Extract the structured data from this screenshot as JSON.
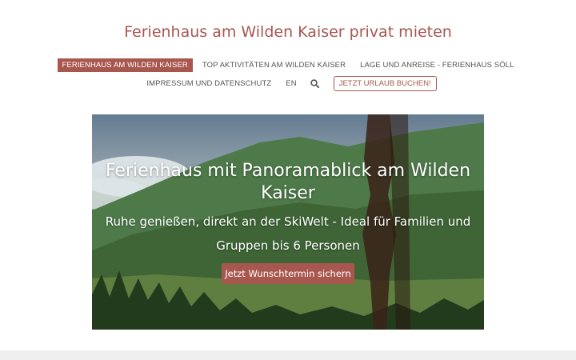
{
  "site": {
    "title": "Ferienhaus am Wilden Kaiser privat mieten"
  },
  "nav": {
    "items": [
      {
        "label": "FERIENHAUS AM WILDEN KAISER",
        "active": true
      },
      {
        "label": "TOP AKTIVITÄTEN AM WILDEN KAISER",
        "active": false
      },
      {
        "label": "LAGE UND ANREISE - FERIENHAUS SÖLL",
        "active": false
      },
      {
        "label": "IMPRESSUM UND DATENSCHUTZ",
        "active": false
      },
      {
        "label": "EN",
        "active": false
      }
    ],
    "search_icon": "search-icon",
    "cta_label": "JETZT URLAUB BUCHEN!"
  },
  "hero": {
    "heading": "Ferienhaus mit Panoramablick am Wilden Kaiser",
    "subheading": "Ruhe genießen, direkt an der SkiWelt - Ideal für Familien und Gruppen bis 6 Personen",
    "button_label": "Jetzt Wunschtermin sichern"
  },
  "colors": {
    "accent": "#a8574f",
    "text": "#555555",
    "footer": "#efefef"
  }
}
